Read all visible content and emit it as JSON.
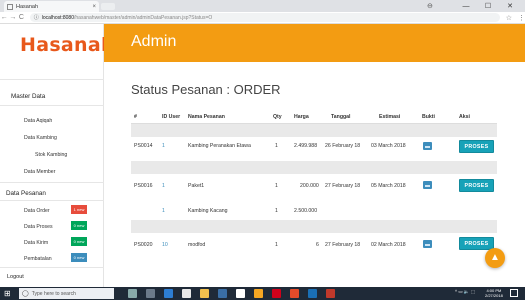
{
  "browser": {
    "tab_title": "Hasanah",
    "url_host": "localhost:8080",
    "url_path": "/hasanahweb/master/admin/adminDataPesanan.jsp?Status=O",
    "tab_close": "×",
    "win_min": "—",
    "win_max": "☐",
    "win_close": "✕",
    "back": "←",
    "forward": "→",
    "reload": "C",
    "info": "ⓘ",
    "star": "☆",
    "menu": "⋮",
    "account": "⊖"
  },
  "logo": {
    "text": "Hasanah"
  },
  "sidebar": {
    "master_data_heading": "Master Data",
    "master_items": [
      "Data Aqiqah",
      "Data Kambing",
      "Stok Kambing",
      "Data Member"
    ],
    "pesanan_heading": "Data Pesanan",
    "pesanan_items": [
      {
        "label": "Data Order",
        "badge": "1 new",
        "color": "#e74c3c"
      },
      {
        "label": "Data Proses",
        "badge": "0 new",
        "color": "#00a65a"
      },
      {
        "label": "Data Kirim",
        "badge": "0 new",
        "color": "#00a65a"
      },
      {
        "label": "Pembatalan",
        "badge": "0 new",
        "color": "#3c8dbc"
      }
    ],
    "logout": "Logout"
  },
  "header": {
    "title": "Admin",
    "color": "#f39c12"
  },
  "main": {
    "title": "Status Pesanan : ORDER",
    "columns": [
      "#",
      "ID User",
      "Nama Pesanan",
      "Qty",
      "Harga",
      "Tanggal",
      "Estimasi",
      "Bukti",
      "Aksi"
    ],
    "rows": [
      {
        "id": "PS0014",
        "user": "1",
        "nama": "Kambing Peranakan Etawa",
        "qty": "1",
        "harga": "2.499.988",
        "tanggal": "26 February 18",
        "estimasi": "03 March 2018",
        "action": "PROSES"
      },
      {
        "id": "PS0016",
        "user": "1",
        "nama": "Paket1",
        "qty": "1",
        "harga": "200.000",
        "tanggal": "27 February 18",
        "estimasi": "05 March 2018",
        "action": "PROSES"
      },
      {
        "id": "",
        "user": "1",
        "nama": "Kambing Kacang",
        "qty": "1",
        "harga": "2.500.000",
        "tanggal": "",
        "estimasi": "",
        "action": ""
      },
      {
        "id": "PS0020",
        "user": "10",
        "nama": "modfod",
        "qty": "1",
        "harga": "6",
        "tanggal": "27 February 18",
        "estimasi": "02 March 2018",
        "action": "PROSES"
      }
    ],
    "fab_icon": "▲"
  },
  "taskbar": {
    "start": "⊞",
    "search_placeholder": "Type here to search",
    "search_icon": "◯",
    "tray": "^ ▭ 🔈 ⬚",
    "time": "4:00 PM",
    "date": "2/27/2018"
  }
}
